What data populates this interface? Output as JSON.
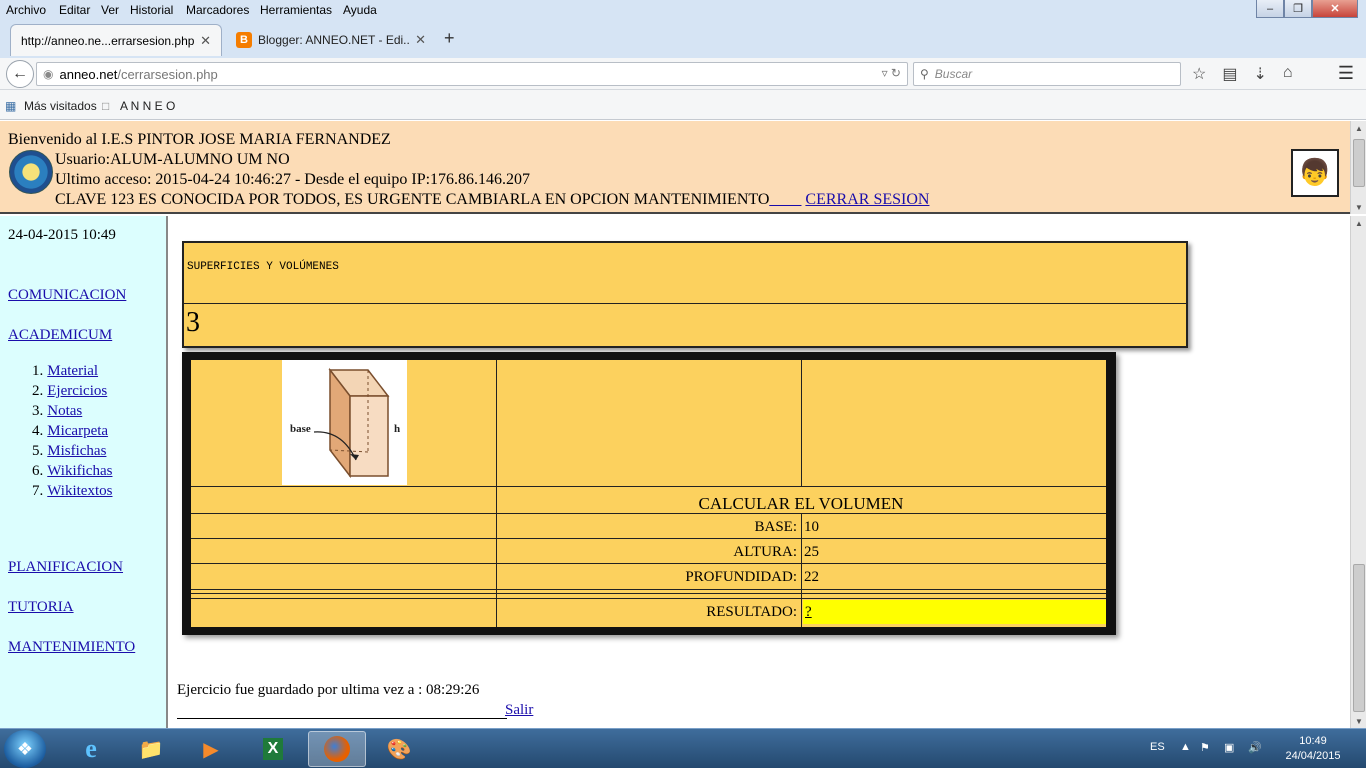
{
  "browser": {
    "menu": [
      "Archivo",
      "Editar",
      "Ver",
      "Historial",
      "Marcadores",
      "Herramientas",
      "Ayuda"
    ],
    "tabs": [
      {
        "title": "http://anneo.ne...errarsesion.php"
      },
      {
        "title": "Blogger: ANNEO.NET - Edi..."
      }
    ],
    "new_tab_symbol": "+",
    "url_host": "anneo.net",
    "url_path": "/cerrarsesion.php",
    "search_placeholder": "Buscar",
    "bookmarks": [
      "Más visitados",
      "A N N E O"
    ]
  },
  "header": {
    "welcome": "Bienvenido al I.E.S PINTOR JOSE MARIA FERNANDEZ",
    "user": "Usuario:ALUM-ALUMNO UM NO",
    "last_access": "Ultimo acceso: 2015-04-24 10:46:27 - Desde el equipo IP:176.86.146.207",
    "warning": "CLAVE 123 ES CONOCIDA POR TODOS, ES URGENTE CAMBIARLA EN OPCION MANTENIMIENTO",
    "logout_label": "CERRAR SESION",
    "logout_prefix": "____"
  },
  "sidebar": {
    "datetime": "24-04-2015 10:49",
    "links": {
      "comunicacion": "COMUNICACION",
      "academicum": "ACADEMICUM",
      "planificacion": "PLANIFICACION",
      "tutoria": "TUTORIA",
      "mantenimiento": "MANTENIMIENTO"
    },
    "academicum_items": [
      {
        "num": "1.",
        "label": "Material"
      },
      {
        "num": "2.",
        "label": "Ejercicios"
      },
      {
        "num": "3.",
        "label": "Notas"
      },
      {
        "num": "4.",
        "label": "Micarpeta"
      },
      {
        "num": "5.",
        "label": "Misfichas"
      },
      {
        "num": "6.",
        "label": "Wikifichas"
      },
      {
        "num": "7.",
        "label": "Wikitextos"
      }
    ]
  },
  "exercise": {
    "title": "SUPERFICIES Y VOLÚMENES",
    "number": "3",
    "figure_labels": {
      "base": "base",
      "h": "h"
    },
    "calc_title": "CALCULAR EL VOLUMEN",
    "fields": [
      {
        "label": "BASE:",
        "value": "10"
      },
      {
        "label": "ALTURA:",
        "value": "25"
      },
      {
        "label": "PROFUNDIDAD:",
        "value": "22"
      }
    ],
    "result_label": "RESULTADO:",
    "result_value": "?",
    "result_color": "#ffff00",
    "saved_text": "Ejercicio fue guardado por ultima vez a : 08:29:26",
    "exit_label": "Salir",
    "panel_color": "#fcd15e"
  },
  "taskbar": {
    "lang": "ES",
    "time": "10:49",
    "date": "24/04/2015",
    "apps": [
      "internet-explorer-icon",
      "folder-icon",
      "media-player-icon",
      "excel-icon",
      "firefox-icon",
      "paint-icon"
    ]
  }
}
